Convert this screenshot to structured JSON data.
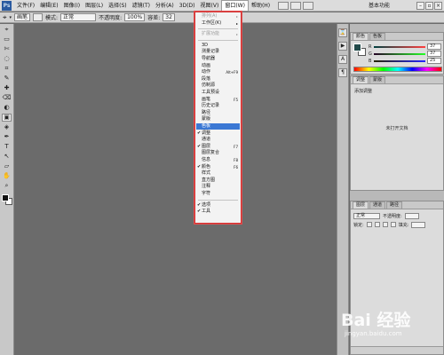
{
  "menubar": {
    "logo": "Ps",
    "items": [
      "文件(F)",
      "编辑(E)",
      "图像(I)",
      "图层(L)",
      "选择(S)",
      "滤镜(T)",
      "分析(A)",
      "3D(D)",
      "视图(V)",
      "窗口(W)",
      "帮助(H)"
    ],
    "active_index": 9,
    "workspace": "基本功能"
  },
  "optbar": {
    "mode_value": "画笔",
    "blend_label": "模式:",
    "blend_value": "正常",
    "opacity_label": "不透明度:",
    "opacity_value": "100%",
    "tolerance_label": "容差:",
    "tolerance_value": "32"
  },
  "toolbar": {
    "tools": [
      "⌖",
      "▭",
      "✄",
      "◌",
      "⌗",
      "✎",
      "✚",
      "⌫",
      "◐",
      "▣",
      "◈",
      "✒",
      "T",
      "↖",
      "▱",
      "✋",
      "⌕"
    ],
    "selected_index": 9
  },
  "window_menu": {
    "items": [
      {
        "label": "排列(A)",
        "disabled": true,
        "arrow": "▸"
      },
      {
        "label": "工作区(K)",
        "disabled": false,
        "arrow": "▸"
      },
      {
        "sep": true
      },
      {
        "label": "扩展功能",
        "disabled": true,
        "arrow": "▸"
      },
      {
        "sep": true
      },
      {
        "label": "3D"
      },
      {
        "label": "测量记录"
      },
      {
        "label": "导航器"
      },
      {
        "label": "动画"
      },
      {
        "label": "动作",
        "shortcut": "Alt+F9"
      },
      {
        "label": "段落"
      },
      {
        "label": "仿制源"
      },
      {
        "label": "工具预设"
      },
      {
        "label": "画笔",
        "shortcut": "F5"
      },
      {
        "label": "历史记录"
      },
      {
        "label": "路径"
      },
      {
        "label": "蒙版"
      },
      {
        "label": "色板",
        "highlight": true
      },
      {
        "label": "调整",
        "check": true
      },
      {
        "label": "通道"
      },
      {
        "label": "图层",
        "shortcut": "F7",
        "check": true
      },
      {
        "label": "图层复合"
      },
      {
        "label": "信息",
        "shortcut": "F8"
      },
      {
        "label": "颜色",
        "shortcut": "F6",
        "check": true
      },
      {
        "label": "样式"
      },
      {
        "label": "直方图"
      },
      {
        "label": "注释"
      },
      {
        "label": "字符"
      },
      {
        "sep": true
      },
      {
        "label": "选项",
        "check": true
      },
      {
        "label": "工具",
        "check": true
      }
    ]
  },
  "color_panel": {
    "tabs": [
      "颜色",
      "色板"
    ],
    "channels": [
      {
        "name": "R",
        "value": "37"
      },
      {
        "name": "G",
        "value": "37"
      },
      {
        "name": "B",
        "value": "25"
      }
    ]
  },
  "adjust_panel": {
    "tabs": [
      "调整",
      "蒙版"
    ],
    "hint": "添加调整",
    "empty_text": "未打开文档"
  },
  "layers_panel": {
    "tabs": [
      "图层",
      "通道",
      "路径"
    ],
    "blend_value": "正常",
    "opacity_label": "不透明度:",
    "lock_label": "锁定:",
    "fill_label": "填充:"
  },
  "watermark": {
    "logo": "Bai 经验",
    "url": "jingyan.baidu.com"
  }
}
